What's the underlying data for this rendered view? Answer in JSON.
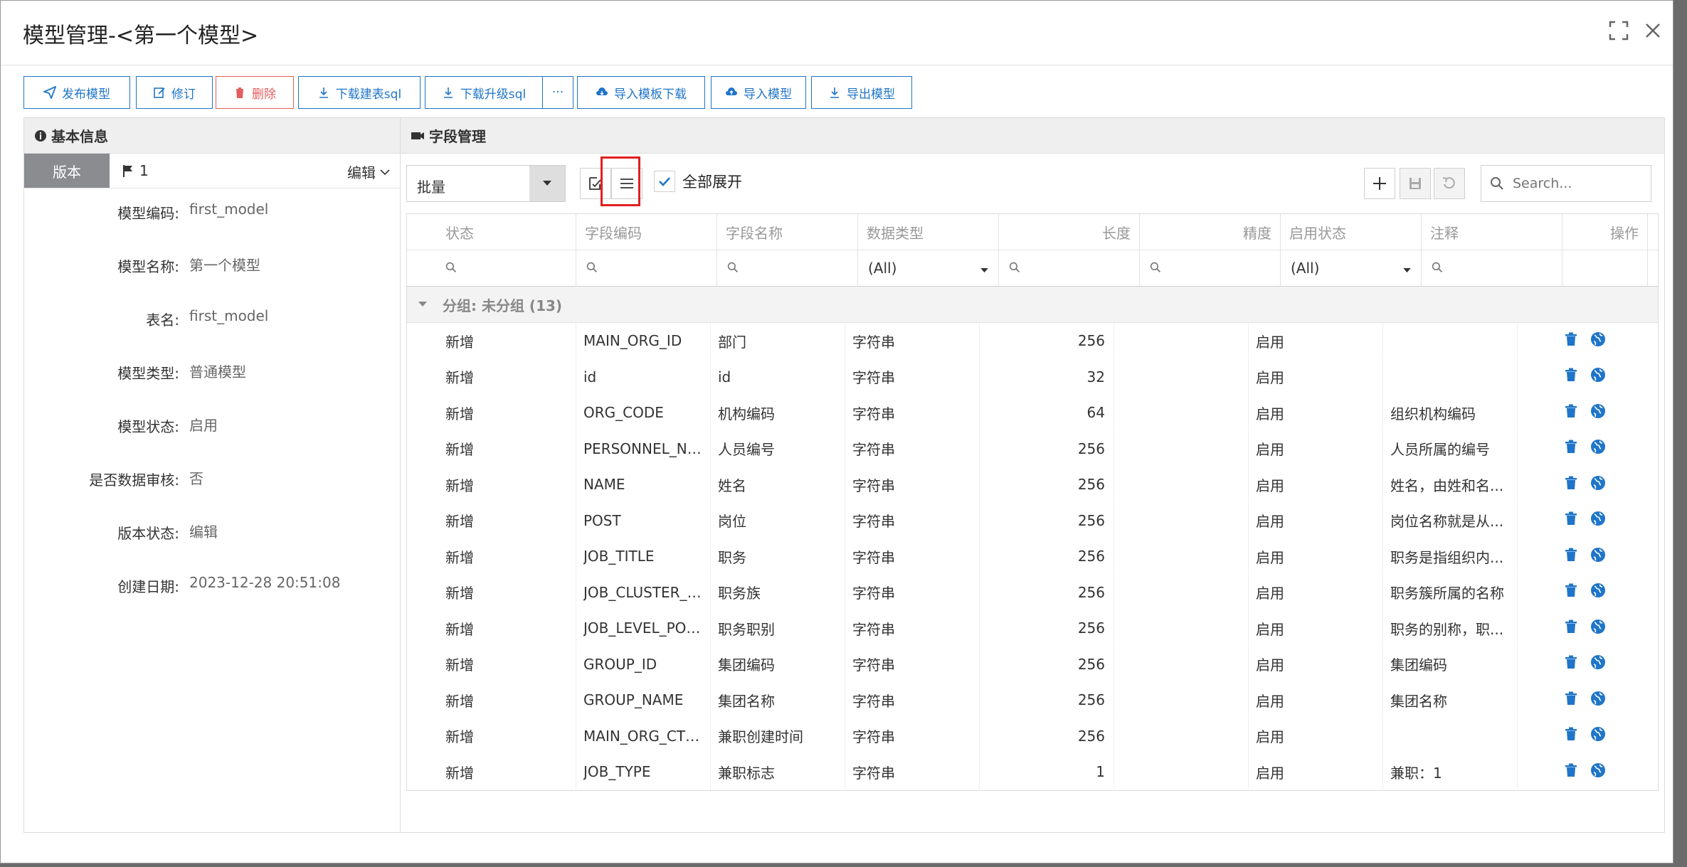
{
  "dialog": {
    "title": "模型管理-<第一个模型>"
  },
  "toolbar": {
    "publish": "发布模型",
    "revise": "修订",
    "delete": "删除",
    "download_create_sql": "下载建表sql",
    "download_upgrade_sql": "下载升级sql",
    "more": "···",
    "import_template_download": "导入模板下载",
    "import_model": "导入模型",
    "export_model": "导出模型"
  },
  "left": {
    "title": "基本信息",
    "version_tab": "版本",
    "version_number": "1",
    "edit_label": "编辑",
    "fields": [
      {
        "label": "模型编码:",
        "value": "first_model"
      },
      {
        "label": "模型名称:",
        "value": "第一个模型"
      },
      {
        "label": "表名:",
        "value": "first_model"
      },
      {
        "label": "模型类型:",
        "value": "普通模型"
      },
      {
        "label": "模型状态:",
        "value": "启用"
      },
      {
        "label": "是否数据审核:",
        "value": "否"
      },
      {
        "label": "版本状态:",
        "value": "编辑"
      },
      {
        "label": "创建日期:",
        "value": "2023-12-28 20:51:08"
      }
    ]
  },
  "right": {
    "title": "字段管理",
    "batch_select": "批量",
    "expand_all": "全部展开",
    "search_placeholder": "Search...",
    "columns": [
      "状态",
      "字段编码",
      "字段名称",
      "数据类型",
      "长度",
      "精度",
      "启用状态",
      "注释",
      "操作"
    ],
    "filter_all": "(All)",
    "group_label": "分组: 未分组 (13)",
    "rows": [
      {
        "status": "新增",
        "code": "MAIN_ORG_ID",
        "name": "部门",
        "type": "字符串",
        "length": "256",
        "precision": "",
        "enabled": "启用",
        "comment": ""
      },
      {
        "status": "新增",
        "code": "id",
        "name": "id",
        "type": "字符串",
        "length": "32",
        "precision": "",
        "enabled": "启用",
        "comment": ""
      },
      {
        "status": "新增",
        "code": "ORG_CODE",
        "name": "机构编码",
        "type": "字符串",
        "length": "64",
        "precision": "",
        "enabled": "启用",
        "comment": "组织机构编码"
      },
      {
        "status": "新增",
        "code": "PERSONNEL_NU...",
        "name": "人员编号",
        "type": "字符串",
        "length": "256",
        "precision": "",
        "enabled": "启用",
        "comment": "人员所属的编号"
      },
      {
        "status": "新增",
        "code": "NAME",
        "name": "姓名",
        "type": "字符串",
        "length": "256",
        "precision": "",
        "enabled": "启用",
        "comment": "姓名，由姓和名..."
      },
      {
        "status": "新增",
        "code": "POST",
        "name": "岗位",
        "type": "字符串",
        "length": "256",
        "precision": "",
        "enabled": "启用",
        "comment": "岗位名称就是从..."
      },
      {
        "status": "新增",
        "code": "JOB_TITLE",
        "name": "职务",
        "type": "字符串",
        "length": "256",
        "precision": "",
        "enabled": "启用",
        "comment": "职务是指组织内..."
      },
      {
        "status": "新增",
        "code": "JOB_CLUSTER_N...",
        "name": "职务族",
        "type": "字符串",
        "length": "256",
        "precision": "",
        "enabled": "启用",
        "comment": "职务簇所属的名称"
      },
      {
        "status": "新增",
        "code": "JOB_LEVEL_POSI...",
        "name": "职务职别",
        "type": "字符串",
        "length": "256",
        "precision": "",
        "enabled": "启用",
        "comment": "职务的别称，职..."
      },
      {
        "status": "新增",
        "code": "GROUP_ID",
        "name": "集团编码",
        "type": "字符串",
        "length": "256",
        "precision": "",
        "enabled": "启用",
        "comment": "集团编码"
      },
      {
        "status": "新增",
        "code": "GROUP_NAME",
        "name": "集团名称",
        "type": "字符串",
        "length": "256",
        "precision": "",
        "enabled": "启用",
        "comment": "集团名称"
      },
      {
        "status": "新增",
        "code": "MAIN_ORG_CTI...",
        "name": "兼职创建时间",
        "type": "字符串",
        "length": "256",
        "precision": "",
        "enabled": "启用",
        "comment": ""
      },
      {
        "status": "新增",
        "code": "JOB_TYPE",
        "name": "兼职标志",
        "type": "字符串",
        "length": "1",
        "precision": "",
        "enabled": "启用",
        "comment": "兼职：1"
      }
    ]
  },
  "colors": {
    "accent": "#1f75c9",
    "danger": "#e35d5d",
    "highlight": "#e02020"
  }
}
